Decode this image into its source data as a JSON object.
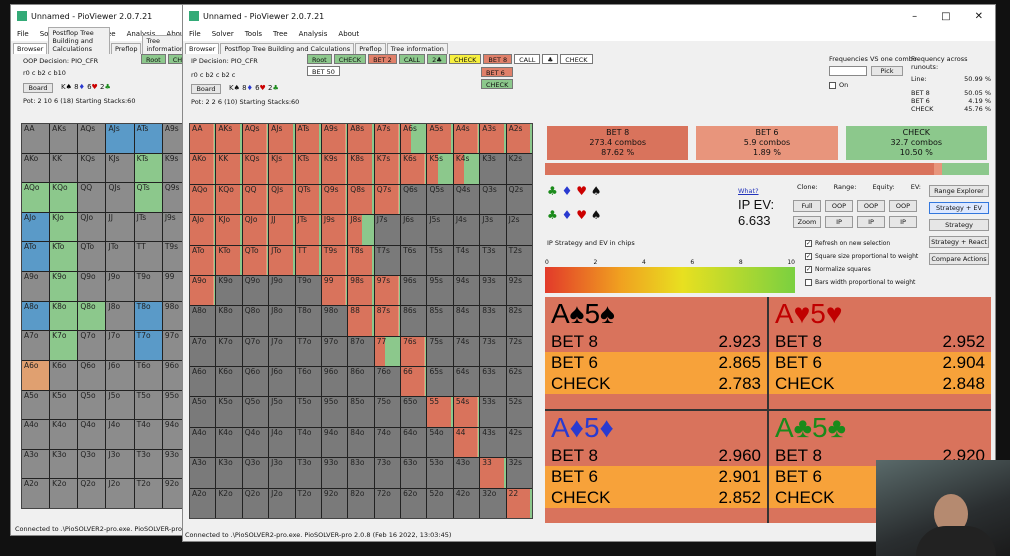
{
  "back_window": {
    "title": "Unnamed - PioViewer 2.0.7.21",
    "menu": [
      "File",
      "Solver",
      "Tools",
      "Tree",
      "Analysis",
      "About"
    ],
    "tabs": [
      "Browser",
      "Postflop Tree Building and Calculations",
      "Preflop",
      "Tree information"
    ],
    "decision": "OOP Decision:  PIO_CFR",
    "board_text": "r0 c b2 c b10",
    "board_btn": "Board",
    "pot": "Pot: 2 10 6 (18) Starting Stacks:60",
    "line": [
      "Root",
      "CH"
    ],
    "status": "Connected to .\\PioSOLVER2-pro.exe. PioSOLVER-pro 2"
  },
  "back_grid": [
    [
      "AA",
      "AKs",
      "AQs",
      "AJs",
      "ATs",
      "A9s"
    ],
    [
      "AKo",
      "KK",
      "KQs",
      "KJs",
      "KTs",
      "K9s"
    ],
    [
      "AQo",
      "KQo",
      "QQ",
      "QJs",
      "QTs",
      "Q9s"
    ],
    [
      "AJo",
      "KJo",
      "QJo",
      "JJ",
      "JTs",
      "J9s"
    ],
    [
      "ATo",
      "KTo",
      "QTo",
      "JTo",
      "TT",
      "T9s"
    ],
    [
      "A9o",
      "K9o",
      "Q9o",
      "J9o",
      "T9o",
      "99"
    ],
    [
      "A8o",
      "K8o",
      "Q8o",
      "J8o",
      "T8o",
      "98o"
    ],
    [
      "A7o",
      "K7o",
      "Q7o",
      "J7o",
      "T7o",
      "97o"
    ],
    [
      "A6o",
      "K6o",
      "Q6o",
      "J6o",
      "T6o",
      "96o"
    ],
    [
      "A5o",
      "K5o",
      "Q5o",
      "J5o",
      "T5o",
      "95o"
    ],
    [
      "A4o",
      "K4o",
      "Q4o",
      "J4o",
      "T4o",
      "94o"
    ],
    [
      "A3o",
      "K3o",
      "Q3o",
      "J3o",
      "T3o",
      "93o"
    ],
    [
      "A2o",
      "K2o",
      "Q2o",
      "J2o",
      "T2o",
      "92o"
    ]
  ],
  "back_colors": [
    [
      "#8c8c8c",
      "#8c8c8c",
      "#8c8c8c",
      "#5a9ac8",
      "#5a9ac8",
      "#8c8c8c"
    ],
    [
      "#8c8c8c",
      "#8c8c8c",
      "#8c8c8c",
      "#8c8c8c",
      "#8cc88c",
      "#8c8c8c"
    ],
    [
      "#8cc88c",
      "#8cc88c",
      "#8c8c8c",
      "#8c8c8c",
      "#8cc88c",
      "#8c8c8c"
    ],
    [
      "#5a9ac8",
      "#8cc88c",
      "#8c8c8c",
      "#8c8c8c",
      "#8c8c8c",
      "#8c8c8c"
    ],
    [
      "#5a9ac8",
      "#8cc88c",
      "#8c8c8c",
      "#8c8c8c",
      "#8c8c8c",
      "#8c8c8c"
    ],
    [
      "#8c8c8c",
      "#8cc88c",
      "#8c8c8c",
      "#8c8c8c",
      "#8c8c8c",
      "#8c8c8c"
    ],
    [
      "#5a9ac8",
      "#8cc88c",
      "#8cc88c",
      "#8c8c8c",
      "#5a9ac8",
      "#8c8c8c"
    ],
    [
      "#8c8c8c",
      "#8cc88c",
      "#8c8c8c",
      "#8c8c8c",
      "#5a9ac8",
      "#8c8c8c"
    ],
    [
      "#e0a070",
      "#8c8c8c",
      "#8c8c8c",
      "#8c8c8c",
      "#8c8c8c",
      "#8c8c8c"
    ],
    [
      "#8c8c8c",
      "#8c8c8c",
      "#8c8c8c",
      "#8c8c8c",
      "#8c8c8c",
      "#8c8c8c"
    ],
    [
      "#8c8c8c",
      "#8c8c8c",
      "#8c8c8c",
      "#8c8c8c",
      "#8c8c8c",
      "#8c8c8c"
    ],
    [
      "#8c8c8c",
      "#8c8c8c",
      "#8c8c8c",
      "#8c8c8c",
      "#8c8c8c",
      "#8c8c8c"
    ],
    [
      "#8c8c8c",
      "#8c8c8c",
      "#8c8c8c",
      "#8c8c8c",
      "#8c8c8c",
      "#8c8c8c"
    ]
  ],
  "front_window": {
    "title": "Unnamed - PioViewer 2.0.7.21",
    "menu": [
      "File",
      "Solver",
      "Tools",
      "Tree",
      "Analysis",
      "About"
    ],
    "tabs": [
      "Browser",
      "Postflop Tree Building and Calculations",
      "Preflop",
      "Tree information"
    ],
    "decision": "IP Decision:  PIO_CFR",
    "board_text": "r0 c b2 c b2 c",
    "board_btn": "Board",
    "pot": "Pot: 2 2 6 (10) Starting Stacks:60",
    "status": "Connected to .\\PioSOLVER2-pro.exe. PioSOLVER-pro 2.0.8 (Feb 16 2022, 13:03:45)",
    "line": [
      {
        "label": "Root",
        "color": "#8cc88c"
      },
      {
        "label": "CHECK",
        "color": "#8cc88c"
      },
      {
        "label": "BET 2",
        "color": "#e0806a"
      },
      {
        "label": "CALL",
        "color": "#8cc88c"
      },
      {
        "label": "2♣",
        "color": "#8cc88c"
      },
      {
        "label": "CHECK",
        "color": "#f7f040"
      },
      {
        "label": "BET 8",
        "color": "#e0806a"
      },
      {
        "label": "CALL",
        "color": "#ffffff"
      },
      {
        "label": "♣",
        "color": "#ffffff"
      },
      {
        "label": "CHECK",
        "color": "#ffffff"
      },
      {
        "label": "BET 50",
        "color": "#ffffff"
      }
    ],
    "line_sub": [
      {
        "label": "BET 6",
        "color": "#e0806a"
      },
      {
        "label": "CHECK",
        "color": "#8cc88c"
      }
    ],
    "freq": {
      "title": "Frequencies VS one combo",
      "pick": "Pick",
      "on": "On"
    },
    "runouts": {
      "title": "Frequency across runouts:",
      "line_label": "Line:",
      "line_val": "50.99 %",
      "rows": [
        [
          "BET 8",
          "50.05 %"
        ],
        [
          "BET 6",
          "4.19 %"
        ],
        [
          "CHECK",
          "45.76 %"
        ]
      ]
    },
    "actions": [
      {
        "label": "BET 8",
        "combos": "273.4 combos",
        "pct": "87.62 %",
        "color": "#d9735c"
      },
      {
        "label": "BET 6",
        "combos": "5.9 combos",
        "pct": "1.89 %",
        "color": "#e8957c"
      },
      {
        "label": "CHECK",
        "combos": "32.7 combos",
        "pct": "10.50 %",
        "color": "#8cc88c"
      }
    ],
    "what": "What?",
    "ev_label": "IP EV:",
    "ev_value": "6.633",
    "legend_label": "IP Strategy and EV in chips",
    "scale": [
      "0",
      "2",
      "4",
      "6",
      "8",
      "10"
    ],
    "clone": "Clone:",
    "range": "Range:",
    "equity": "Equity:",
    "ev": "EV:",
    "btns_row1": [
      "Full",
      "OOP",
      "OOP",
      "OOP"
    ],
    "btns_row2": [
      "Zoom",
      "IP",
      "IP",
      "IP"
    ],
    "checks": [
      "Refresh on new selection",
      "Square size proportional to weight",
      "Normalize squares",
      "Bars width proportional to weight"
    ],
    "right_btns": [
      "Range Explorer",
      "Strategy + EV",
      "Strategy",
      "Strategy + React",
      "Compare Actions"
    ],
    "combos": [
      {
        "title": "A♠5♠",
        "suit_color": "#000000",
        "rows": [
          [
            "BET 8",
            "2.923"
          ],
          [
            "BET 6",
            "2.865"
          ],
          [
            "CHECK",
            "2.783"
          ]
        ]
      },
      {
        "title": "A♥5♥",
        "suit_color": "#c00000",
        "rows": [
          [
            "BET 8",
            "2.952"
          ],
          [
            "BET 6",
            "2.904"
          ],
          [
            "CHECK",
            "2.848"
          ]
        ]
      },
      {
        "title": "A♦5♦",
        "suit_color": "#2a3ad0",
        "rows": [
          [
            "BET 8",
            "2.960"
          ],
          [
            "BET 6",
            "2.901"
          ],
          [
            "CHECK",
            "2.852"
          ]
        ]
      },
      {
        "title": "A♣5♣",
        "suit_color": "#1a8a1a",
        "rows": [
          [
            "BET 8",
            "2.920"
          ],
          [
            "BET 6",
            ""
          ],
          [
            "CHECK",
            ""
          ]
        ]
      }
    ]
  },
  "front_grid": [
    [
      "AA",
      "AKs",
      "AQs",
      "AJs",
      "ATs",
      "A9s",
      "A8s",
      "A7s",
      "A6s",
      "A5s",
      "A4s",
      "A3s",
      "A2s"
    ],
    [
      "AKo",
      "KK",
      "KQs",
      "KJs",
      "KTs",
      "K9s",
      "K8s",
      "K7s",
      "K6s",
      "K5s",
      "K4s",
      "K3s",
      "K2s"
    ],
    [
      "AQo",
      "KQo",
      "QQ",
      "QJs",
      "QTs",
      "Q9s",
      "Q8s",
      "Q7s",
      "Q6s",
      "Q5s",
      "Q4s",
      "Q3s",
      "Q2s"
    ],
    [
      "AJo",
      "KJo",
      "QJo",
      "JJ",
      "JTs",
      "J9s",
      "J8s",
      "J7s",
      "J6s",
      "J5s",
      "J4s",
      "J3s",
      "J2s"
    ],
    [
      "ATo",
      "KTo",
      "QTo",
      "JTo",
      "TT",
      "T9s",
      "T8s",
      "T7s",
      "T6s",
      "T5s",
      "T4s",
      "T3s",
      "T2s"
    ],
    [
      "A9o",
      "K9o",
      "Q9o",
      "J9o",
      "T9o",
      "99",
      "98s",
      "97s",
      "96s",
      "95s",
      "94s",
      "93s",
      "92s"
    ],
    [
      "A8o",
      "K8o",
      "Q8o",
      "J8o",
      "T8o",
      "98o",
      "88",
      "87s",
      "86s",
      "85s",
      "84s",
      "83s",
      "82s"
    ],
    [
      "A7o",
      "K7o",
      "Q7o",
      "J7o",
      "T7o",
      "97o",
      "87o",
      "77",
      "76s",
      "75s",
      "74s",
      "73s",
      "72s"
    ],
    [
      "A6o",
      "K6o",
      "Q6o",
      "J6o",
      "T6o",
      "96o",
      "86o",
      "76o",
      "66",
      "65s",
      "64s",
      "63s",
      "62s"
    ],
    [
      "A5o",
      "K5o",
      "Q5o",
      "J5o",
      "T5o",
      "95o",
      "85o",
      "75o",
      "65o",
      "55",
      "54s",
      "53s",
      "52s"
    ],
    [
      "A4o",
      "K4o",
      "Q4o",
      "J4o",
      "T4o",
      "94o",
      "84o",
      "74o",
      "64o",
      "54o",
      "44",
      "43s",
      "42s"
    ],
    [
      "A3o",
      "K3o",
      "Q3o",
      "J3o",
      "T3o",
      "93o",
      "83o",
      "73o",
      "63o",
      "53o",
      "43o",
      "33",
      "32s"
    ],
    [
      "A2o",
      "K2o",
      "Q2o",
      "J2o",
      "T2o",
      "92o",
      "82o",
      "72o",
      "62o",
      "52o",
      "42o",
      "32o",
      "22"
    ]
  ],
  "front_fill": [
    [
      1,
      1,
      1,
      1,
      1,
      1,
      1,
      1,
      2,
      1,
      1,
      1,
      1
    ],
    [
      1,
      1,
      1,
      1,
      1,
      1,
      1,
      1,
      1,
      2,
      2,
      0,
      0
    ],
    [
      1,
      1,
      1,
      1,
      1,
      1,
      1,
      1,
      0,
      0,
      0,
      0,
      0
    ],
    [
      1,
      1,
      1,
      1,
      1,
      1,
      3,
      0,
      0,
      0,
      0,
      0,
      0
    ],
    [
      1,
      1,
      1,
      1,
      1,
      1,
      1,
      0,
      0,
      0,
      0,
      0,
      0
    ],
    [
      1,
      0,
      0,
      0,
      0,
      1,
      1,
      1,
      0,
      0,
      0,
      0,
      0
    ],
    [
      0,
      0,
      0,
      0,
      0,
      0,
      1,
      1,
      0,
      0,
      0,
      0,
      0
    ],
    [
      0,
      0,
      0,
      0,
      0,
      0,
      0,
      2,
      1,
      0,
      0,
      0,
      0
    ],
    [
      0,
      0,
      0,
      0,
      0,
      0,
      0,
      0,
      1,
      0,
      0,
      0,
      0
    ],
    [
      0,
      0,
      0,
      0,
      0,
      0,
      0,
      0,
      0,
      1,
      1,
      0,
      0
    ],
    [
      0,
      0,
      0,
      0,
      0,
      0,
      0,
      0,
      0,
      0,
      1,
      0,
      0
    ],
    [
      0,
      0,
      0,
      0,
      0,
      0,
      0,
      0,
      0,
      0,
      0,
      1,
      0
    ],
    [
      0,
      0,
      0,
      0,
      0,
      0,
      0,
      0,
      0,
      0,
      0,
      0,
      1
    ]
  ],
  "colors": {
    "bet": "#d9735c",
    "check": "#8cc88c",
    "fold": "#7a7a7a",
    "mixed": "#e8957c",
    "orange": "#f7a23a",
    "ev_bg": "#d9735c"
  }
}
